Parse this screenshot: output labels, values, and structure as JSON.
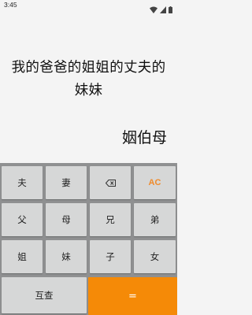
{
  "status_bar": {
    "time": "3:45",
    "icons": [
      "wifi-icon",
      "cellular-signal-icon",
      "battery-icon"
    ]
  },
  "display": {
    "expression": "我的爸爸的姐姐的丈夫的妹妹",
    "result": "姻伯母"
  },
  "keypad": {
    "row1": [
      "夫",
      "妻",
      "backspace-icon",
      "AC"
    ],
    "row2": [
      "父",
      "母",
      "兄",
      "弟"
    ],
    "row3": [
      "姐",
      "妹",
      "子",
      "女"
    ],
    "row4": [
      "互查",
      "="
    ]
  },
  "colors": {
    "accent": "#f58a07",
    "key_background": "#d6d7d7",
    "keypad_background": "#8f9091",
    "ac_text": "#ef8b2c"
  }
}
